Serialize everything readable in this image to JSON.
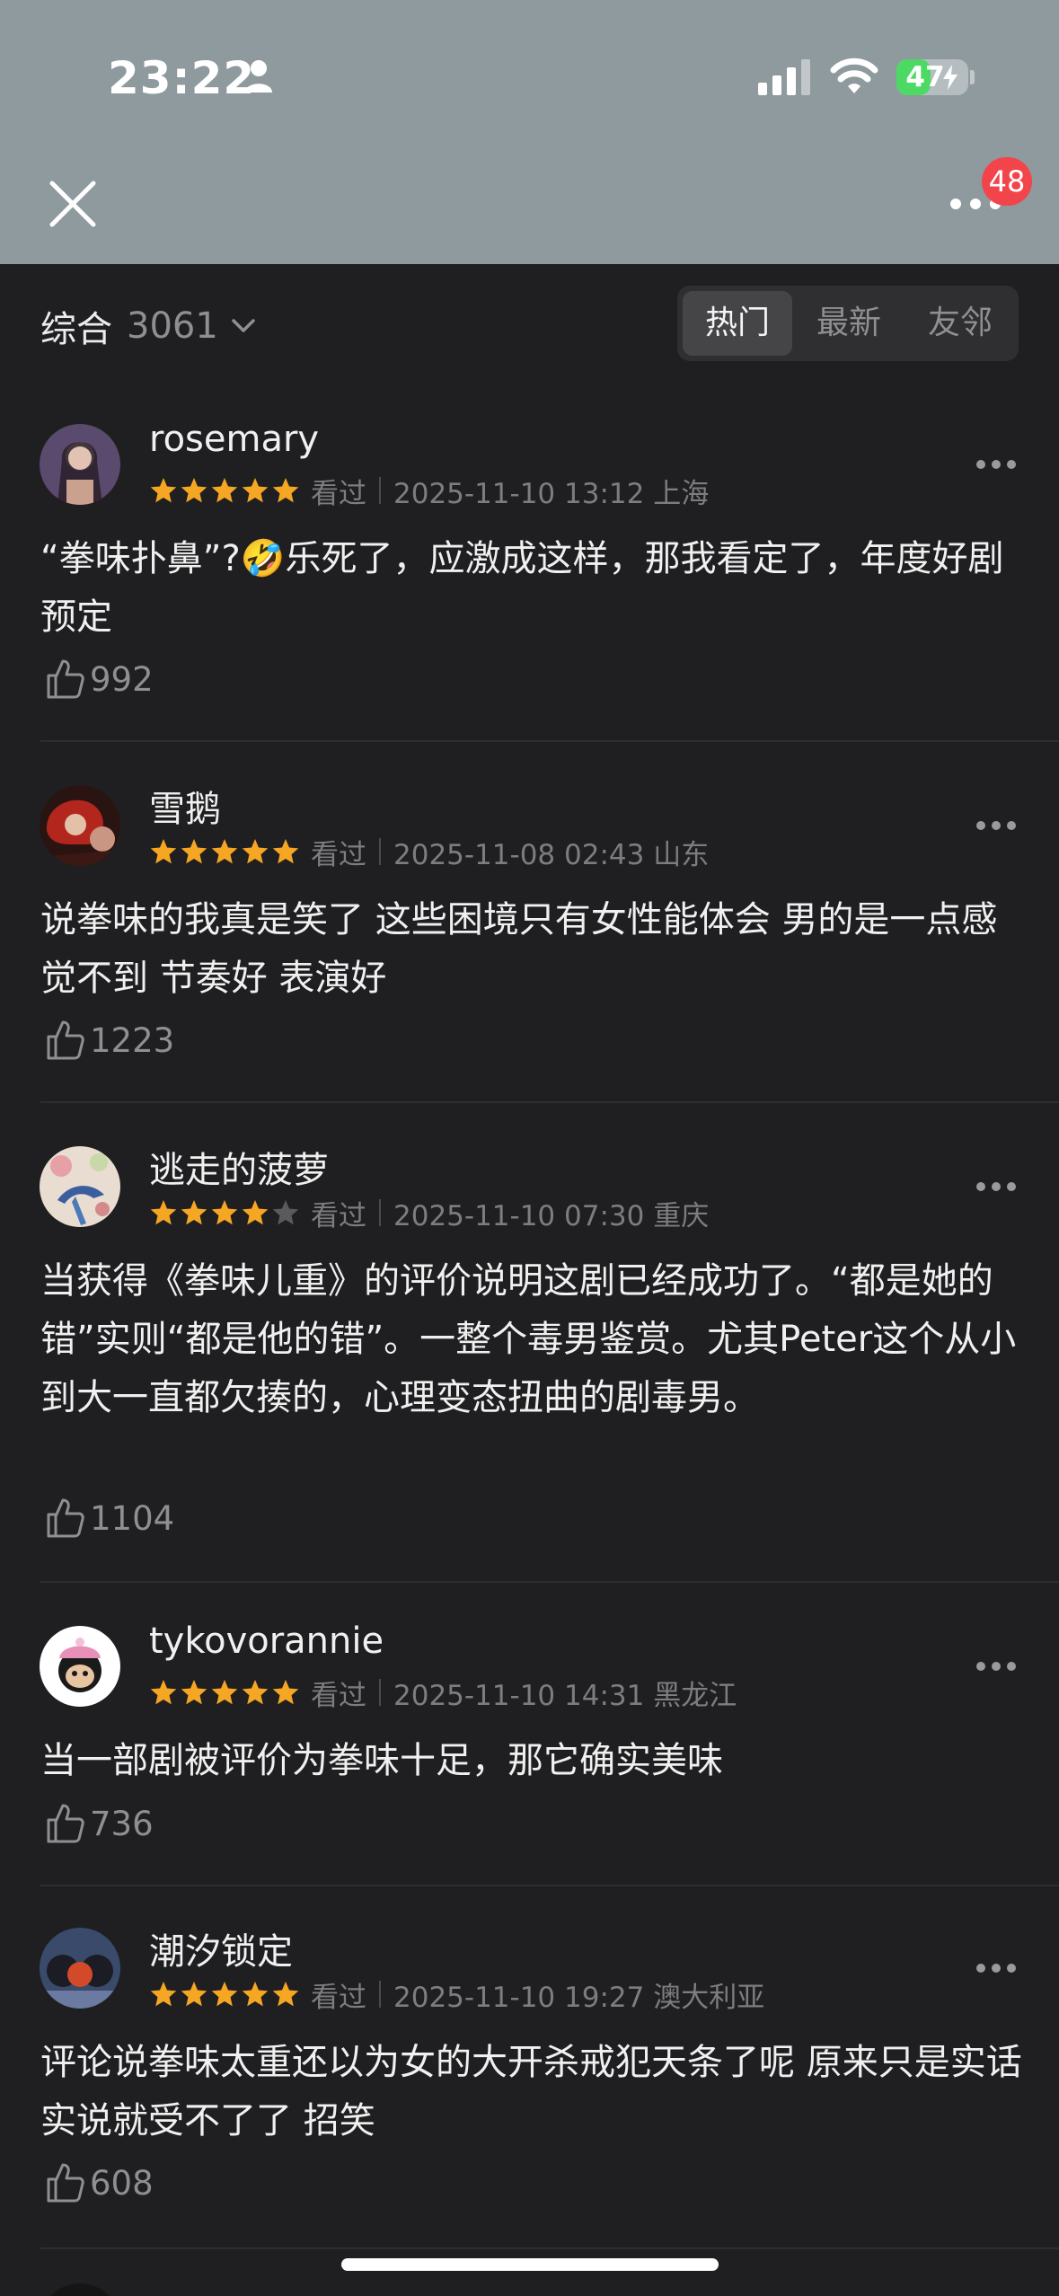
{
  "status_bar": {
    "time": "23:22",
    "battery_level": "47",
    "battery_fraction": 0.47
  },
  "header": {
    "notification_badge": "48"
  },
  "filter": {
    "label": "综合",
    "count": "3061",
    "tabs": [
      {
        "label": "热门",
        "active": true
      },
      {
        "label": "最新",
        "active": false
      },
      {
        "label": "友邻",
        "active": false
      }
    ]
  },
  "comments": [
    {
      "username": "rosemary",
      "rating": 5,
      "status": "看过",
      "datetime": "2025-11-10 13:12 上海",
      "text": "“拳味扑鼻”?🤣乐死了，应激成这样，那我看定了，年度好剧预定",
      "likes": "992"
    },
    {
      "username": "雪鹅",
      "rating": 5,
      "status": "看过",
      "datetime": "2025-11-08 02:43 山东",
      "text": "说拳味的我真是笑了 这些困境只有女性能体会 男的是一点感觉不到 节奏好 表演好",
      "likes": "1223"
    },
    {
      "username": "逃走的菠萝",
      "rating": 4,
      "status": "看过",
      "datetime": "2025-11-10 07:30 重庆",
      "text": "当获得《拳味儿重》的评价说明这剧已经成功了。“都是她的错”实则“都是他的错”。一整个毒男鉴赏。尤其Peter这个从小到大一直都欠揍的，心理变态扭曲的剧毒男。",
      "likes": "1104"
    },
    {
      "username": "tykovorannie",
      "rating": 5,
      "status": "看过",
      "datetime": "2025-11-10 14:31 黑龙江",
      "text": "当一部剧被评价为拳味十足，那它确实美味",
      "likes": "736"
    },
    {
      "username": "潮汐锁定",
      "rating": 5,
      "status": "看过",
      "datetime": "2025-11-10 19:27 澳大利亚",
      "text": "评论说拳味太重还以为女的大开杀戒犯天条了呢 原来只是实话实说就受不了了 招笑",
      "likes": "608"
    }
  ],
  "colors": {
    "header_bg": "#8e9a9e",
    "page_bg": "#1f1f21",
    "star": "#f5a623",
    "badge": "#f2454b",
    "battery": "#4cd964"
  },
  "icons": [
    "person-icon",
    "signal-icon",
    "wifi-icon",
    "battery-icon",
    "close-icon",
    "more-icon",
    "chevron-down-icon",
    "star-icon",
    "thumbs-up-icon"
  ]
}
